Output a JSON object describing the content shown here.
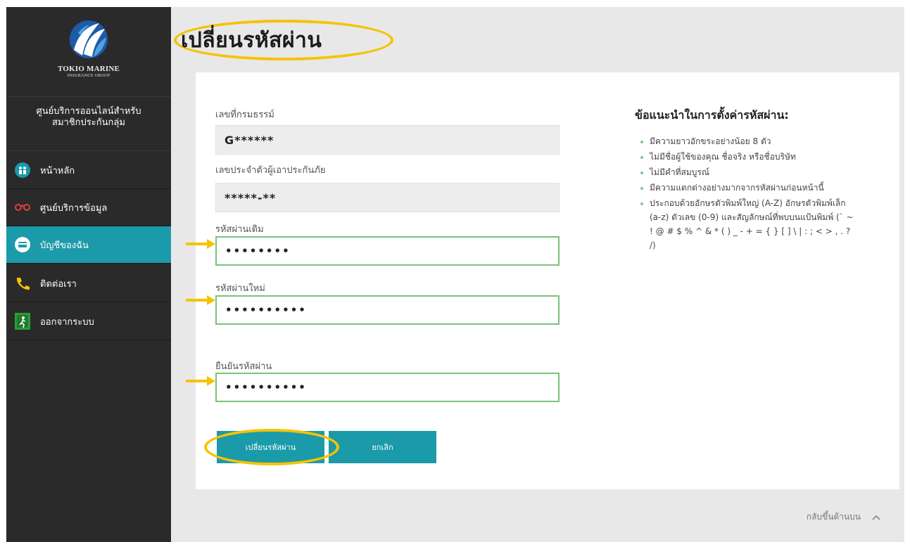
{
  "brand": {
    "name": "TOKIO MARINE",
    "subtitle": "INSURANCE GROUP"
  },
  "sidebar": {
    "service_title_line1": "ศูนย์บริการออนไลน์สำหรับ",
    "service_title_line2": "สมาชิกประกันกลุ่ม",
    "items": [
      {
        "label": "หน้าหลัก",
        "icon": "people-icon"
      },
      {
        "label": "ศูนย์บริการข้อมูล",
        "icon": "glasses-icon"
      },
      {
        "label": "บัญชีของฉัน",
        "icon": "card-icon"
      },
      {
        "label": "ติดต่อเรา",
        "icon": "phone-icon"
      },
      {
        "label": "ออกจากระบบ",
        "icon": "exit-icon"
      }
    ],
    "active_index": 2
  },
  "page": {
    "title": "เปลี่ยนรหัสผ่าน"
  },
  "form": {
    "policy_label": "เลขที่กรมธรรม์",
    "policy_value": "G******",
    "insured_label": "เลขประจำตัวผู้เอาประกันภัย",
    "insured_value": "*****-**",
    "old_password_label": "รหัสผ่านเดิม",
    "old_password_value": "••••••••",
    "new_password_label": "รหัสผ่านใหม่",
    "new_password_value": "••••••••••",
    "confirm_password_label": "ยืนยันรหัสผ่าน",
    "confirm_password_value": "••••••••••",
    "submit_label": "เปลี่ยนรหัสผ่าน",
    "cancel_label": "ยกเลิก"
  },
  "tips": {
    "title": "ข้อแนะนำในการตั้งค่ารหัสผ่าน:",
    "items": [
      "มีความยาวอักขระอย่างน้อย 8 ตัว",
      "ไม่มีชื่อผู้ใช้ของคุณ ชื่อจริง หรือชื่อบริษัท",
      "ไม่มีคำที่สมบูรณ์",
      "มีความแตกต่างอย่างมากจากรหัสผ่านก่อนหน้านี้",
      "ประกอบด้วยอักษรตัวพิมพ์ใหญ่ (A-Z) อักษรตัวพิมพ์เล็ก (a-z) ตัวเลข (0-9) และสัญลักษณ์ที่พบบนแป้นพิมพ์ (` ~ ! @ # $ % ^ & * ( ) _ - + = { } [ ] \\ | : ; < > , . ? /)"
    ]
  },
  "footer": {
    "back_to_top": "กลับขึ้นด้านบน"
  },
  "colors": {
    "accent": "#1b9aaa",
    "highlight": "#f5c300",
    "input_border": "#7bc27b",
    "sidebar_bg": "#2a2a2a"
  }
}
